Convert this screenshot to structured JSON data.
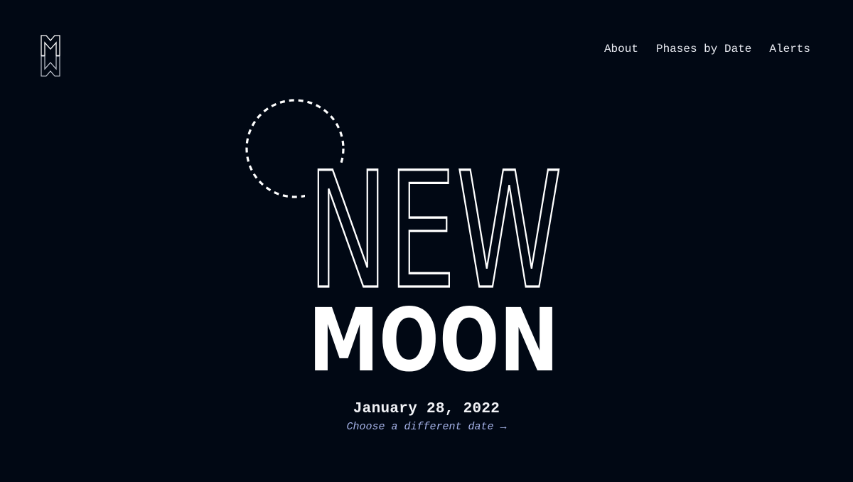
{
  "site": {
    "logo_icon": "moon-logo-icon"
  },
  "nav": {
    "items": [
      {
        "label": "About"
      },
      {
        "label": "Phases by Date"
      },
      {
        "label": "Alerts"
      }
    ]
  },
  "hero": {
    "phase_line1": "NEW",
    "phase_line2": "MOON",
    "moon_icon": "dashed-circle-moon-icon",
    "date": "January 28, 2022",
    "change_date_label": "Choose a different date →"
  },
  "colors": {
    "background": "#010814",
    "text": "#ffffff",
    "link_accent": "#a7b4ea"
  }
}
